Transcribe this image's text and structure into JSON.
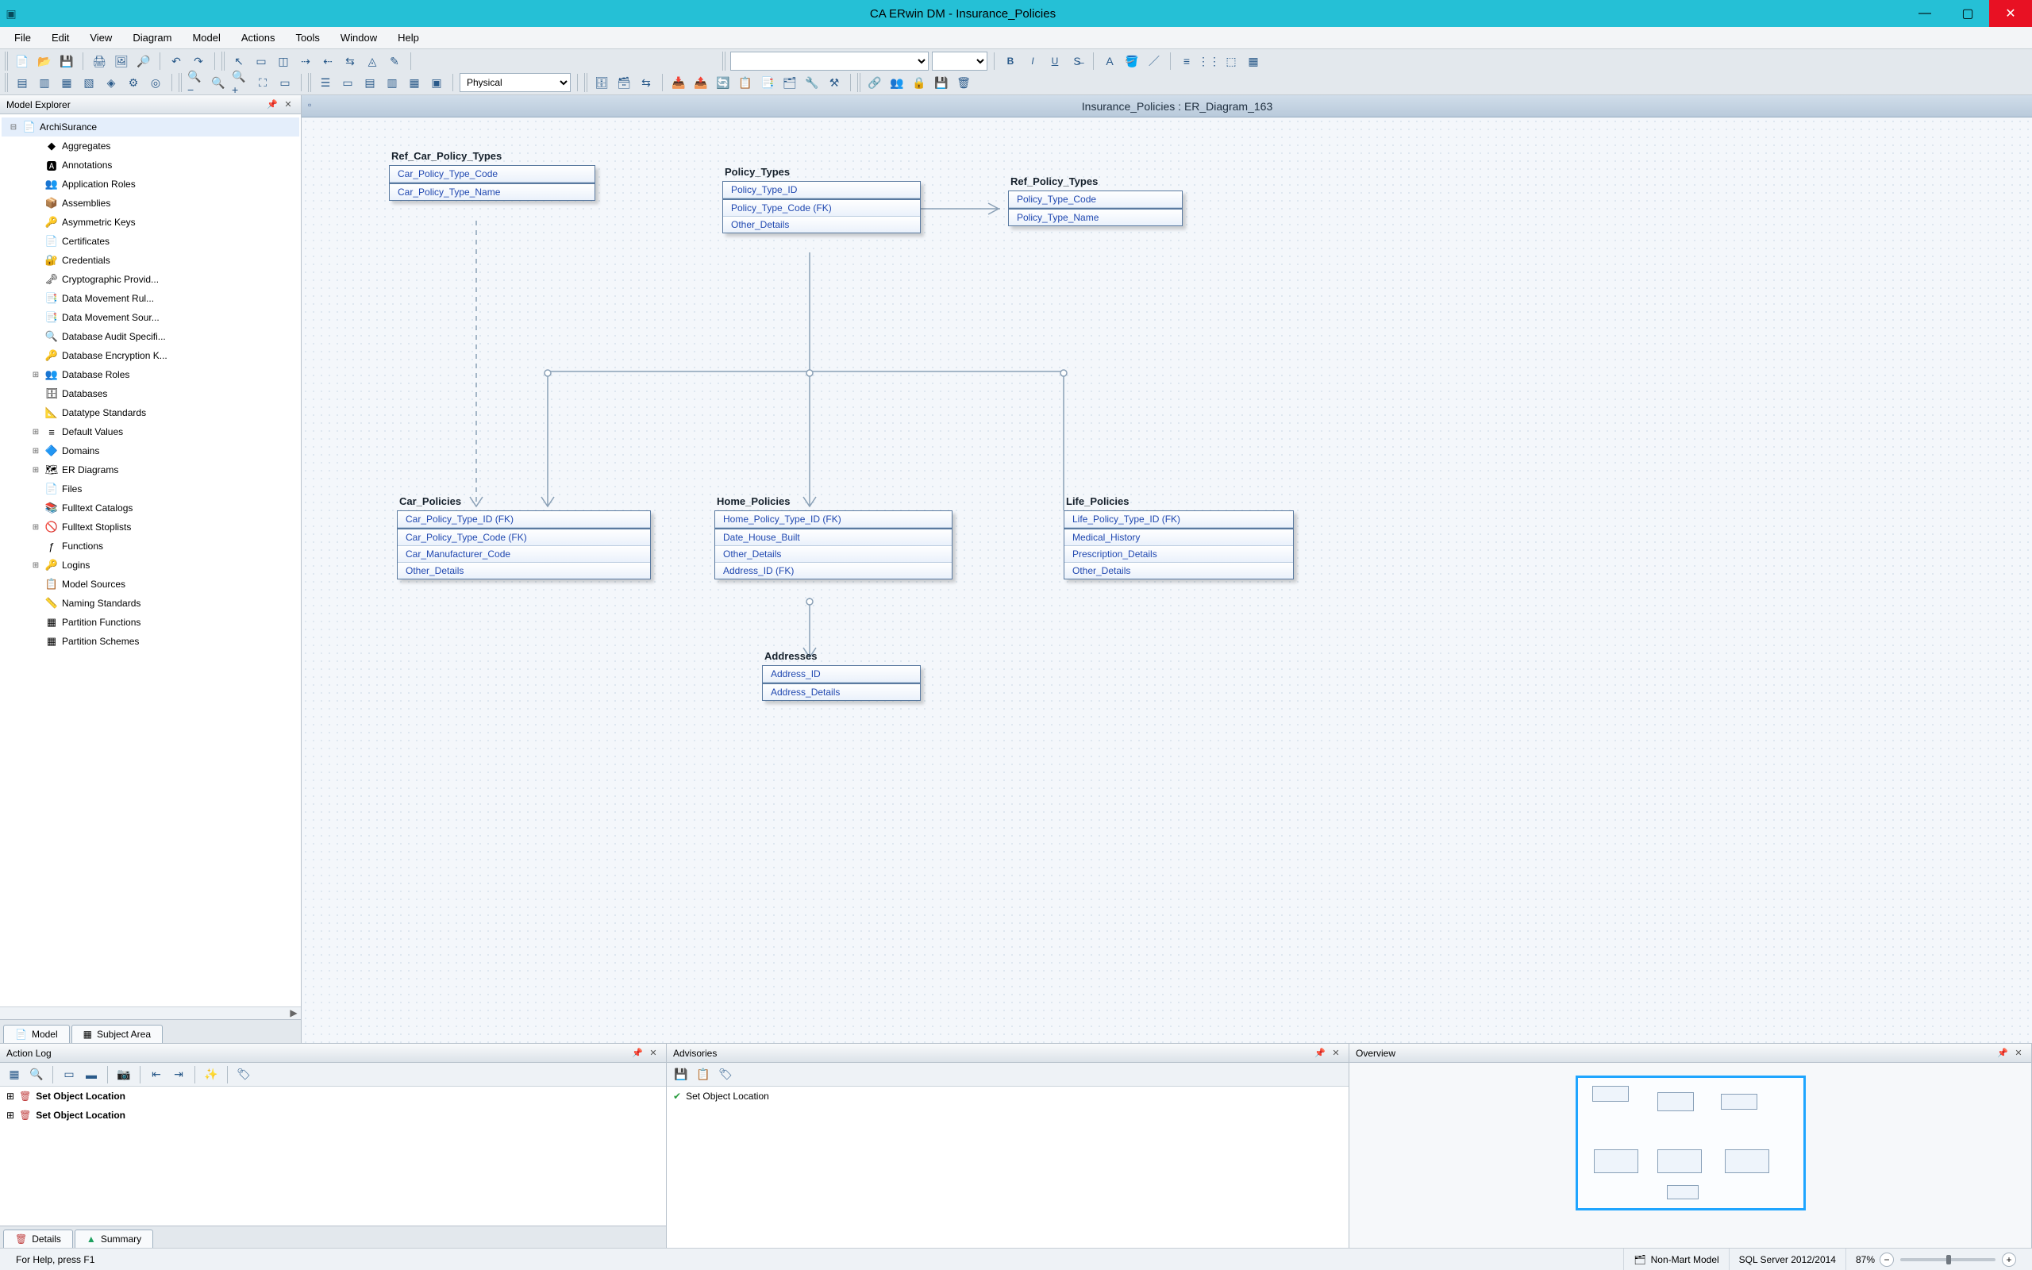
{
  "titlebar": {
    "app_label": "CA ERwin DM - Insurance_Policies"
  },
  "menu": {
    "items": [
      "File",
      "Edit",
      "View",
      "Diagram",
      "Model",
      "Actions",
      "Tools",
      "Window",
      "Help"
    ]
  },
  "toolbars": {
    "physical_select": "Physical"
  },
  "model_explorer": {
    "title": "Model Explorer",
    "root": "ArchiSurance",
    "items": [
      {
        "label": "Aggregates",
        "icon": "◆"
      },
      {
        "label": "Annotations",
        "icon": "🅰"
      },
      {
        "label": "Application Roles",
        "icon": "👥"
      },
      {
        "label": "Assemblies",
        "icon": "📦"
      },
      {
        "label": "Asymmetric Keys",
        "icon": "🔑"
      },
      {
        "label": "Certificates",
        "icon": "📄"
      },
      {
        "label": "Credentials",
        "icon": "🔐"
      },
      {
        "label": "Cryptographic Provid...",
        "icon": "🗝"
      },
      {
        "label": "Data Movement Rul...",
        "icon": "📑"
      },
      {
        "label": "Data Movement Sour...",
        "icon": "📑"
      },
      {
        "label": "Database Audit Specifi...",
        "icon": "🔍"
      },
      {
        "label": "Database Encryption K...",
        "icon": "🔑"
      },
      {
        "label": "Database Roles",
        "icon": "👥",
        "exp": "⊞"
      },
      {
        "label": "Databases",
        "icon": "🗄"
      },
      {
        "label": "Datatype Standards",
        "icon": "📐"
      },
      {
        "label": "Default Values",
        "icon": "≡",
        "exp": "⊞"
      },
      {
        "label": "Domains",
        "icon": "🔷",
        "exp": "⊞"
      },
      {
        "label": "ER Diagrams",
        "icon": "🗺",
        "exp": "⊞"
      },
      {
        "label": "Files",
        "icon": "📄"
      },
      {
        "label": "Fulltext Catalogs",
        "icon": "📚"
      },
      {
        "label": "Fulltext Stoplists",
        "icon": "🚫",
        "exp": "⊞"
      },
      {
        "label": "Functions",
        "icon": "ƒ"
      },
      {
        "label": "Logins",
        "icon": "🔑",
        "exp": "⊞"
      },
      {
        "label": "Model Sources",
        "icon": "📋"
      },
      {
        "label": "Naming Standards",
        "icon": "📏"
      },
      {
        "label": "Partition Functions",
        "icon": "▦"
      },
      {
        "label": "Partition Schemes",
        "icon": "▦"
      }
    ],
    "tabs": {
      "model": "Model",
      "subject": "Subject Area"
    }
  },
  "diagram": {
    "title": "Insurance_Policies : ER_Diagram_163",
    "entities": {
      "refcar": {
        "name": "Ref_Car_Policy_Types",
        "pk": [
          "Car_Policy_Type_Code"
        ],
        "attrs": [
          "Car_Policy_Type_Name"
        ]
      },
      "ptypes": {
        "name": "Policy_Types",
        "pk": [
          "Policy_Type_ID"
        ],
        "attrs": [
          "Policy_Type_Code (FK)",
          "Other_Details"
        ]
      },
      "refpol": {
        "name": "Ref_Policy_Types",
        "pk": [
          "Policy_Type_Code"
        ],
        "attrs": [
          "Policy_Type_Name"
        ]
      },
      "carpol": {
        "name": "Car_Policies",
        "pk": [
          "Car_Policy_Type_ID (FK)"
        ],
        "attrs": [
          "Car_Policy_Type_Code (FK)",
          "Car_Manufacturer_Code",
          "Other_Details"
        ]
      },
      "homepol": {
        "name": "Home_Policies",
        "pk": [
          "Home_Policy_Type_ID (FK)"
        ],
        "attrs": [
          "Date_House_Built",
          "Other_Details",
          "Address_ID (FK)"
        ]
      },
      "lifepol": {
        "name": "Life_Policies",
        "pk": [
          "Life_Policy_Type_ID (FK)"
        ],
        "attrs": [
          "Medical_History",
          "Prescription_Details",
          "Other_Details"
        ]
      },
      "addr": {
        "name": "Addresses",
        "pk": [
          "Address_ID"
        ],
        "attrs": [
          "Address_Details"
        ]
      }
    }
  },
  "action_log": {
    "title": "Action Log",
    "rows": [
      "Set Object Location",
      "Set Object Location"
    ],
    "tabs": {
      "details": "Details",
      "summary": "Summary"
    }
  },
  "advisories": {
    "title": "Advisories",
    "rows": [
      "Set Object Location"
    ]
  },
  "overview": {
    "title": "Overview"
  },
  "statusbar": {
    "help": "For Help, press F1",
    "mart": "Non-Mart Model",
    "server": "SQL Server 2012/2014",
    "zoom": "87%"
  }
}
